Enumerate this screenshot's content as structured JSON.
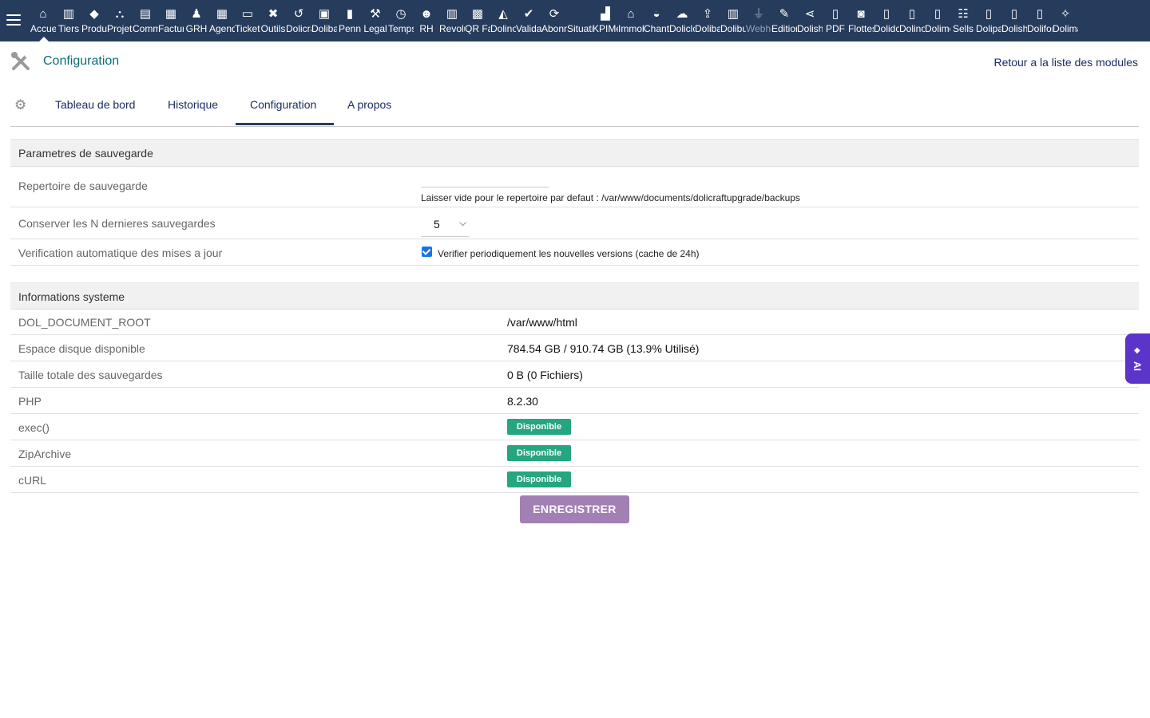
{
  "topbar": {
    "menu_items": [
      {
        "label": "Accueil",
        "icon": "home-icon",
        "glyph": "⌂"
      },
      {
        "label": "Tiers",
        "icon": "building-icon",
        "glyph": "▥"
      },
      {
        "label": "Produits",
        "icon": "cube-icon",
        "glyph": "◆"
      },
      {
        "label": "Projets",
        "icon": "project-icon",
        "glyph": "⛬"
      },
      {
        "label": "Commercial",
        "icon": "briefcase-icon",
        "glyph": "▤"
      },
      {
        "label": "Facturation",
        "icon": "invoice-icon",
        "glyph": "▦"
      },
      {
        "label": "GRH",
        "icon": "user-tie-icon",
        "glyph": "♟"
      },
      {
        "label": "Agenda",
        "icon": "calendar-icon",
        "glyph": "▦"
      },
      {
        "label": "Tickets",
        "icon": "ticket-icon",
        "glyph": "▭"
      },
      {
        "label": "Outils",
        "icon": "tools-icon",
        "glyph": "✖"
      },
      {
        "label": "Dolicraft",
        "icon": "undo-icon",
        "glyph": "↺"
      },
      {
        "label": "Dolibarr",
        "icon": "toolbox-icon",
        "glyph": "▣"
      },
      {
        "label": "Penn",
        "icon": "file-icon",
        "glyph": "▮"
      },
      {
        "label": "Legal",
        "icon": "gavel-icon",
        "glyph": "⚒"
      },
      {
        "label": "Temps",
        "icon": "clock-icon",
        "glyph": "◷"
      },
      {
        "label": "RH",
        "icon": "users-icon",
        "glyph": "☻"
      },
      {
        "label": "Revolut",
        "icon": "bank-icon",
        "glyph": "▥"
      },
      {
        "label": "QR Facture",
        "icon": "qrcode-icon",
        "glyph": "▩"
      },
      {
        "label": "Dolinotif",
        "icon": "bell-icon",
        "glyph": "◭"
      },
      {
        "label": "Validation",
        "icon": "check-double-icon",
        "glyph": "✔"
      },
      {
        "label": "Abonnements",
        "icon": "refresh-icon",
        "glyph": "⟳"
      },
      {
        "label": "Situation",
        "icon": "blank-icon",
        "glyph": ""
      },
      {
        "label": "KPIMetrics",
        "icon": "chart-icon",
        "glyph": "▟"
      },
      {
        "label": "Immobilier",
        "icon": "house-icon",
        "glyph": "⌂"
      },
      {
        "label": "Chantier",
        "icon": "helmet-icon",
        "glyph": "◒"
      },
      {
        "label": "Dolicloud",
        "icon": "cloud-icon",
        "glyph": "☁"
      },
      {
        "label": "Dolibackup",
        "icon": "upload-icon",
        "glyph": "⇪"
      },
      {
        "label": "Dolibuild",
        "icon": "tower-icon",
        "glyph": "▥"
      },
      {
        "label": "Webhooks",
        "icon": "plug-icon",
        "glyph": "⏚",
        "dim": true
      },
      {
        "label": "Editions",
        "icon": "edit-icon",
        "glyph": "✎"
      },
      {
        "label": "Dolishare",
        "icon": "share-icon",
        "glyph": "⋖"
      },
      {
        "label": "PDF",
        "icon": "pdf-icon",
        "glyph": "▯"
      },
      {
        "label": "Flottes",
        "icon": "car-icon",
        "glyph": "◙"
      },
      {
        "label": "Dolidoc",
        "icon": "doc-icon",
        "glyph": "▯"
      },
      {
        "label": "Dolinote",
        "icon": "note-icon",
        "glyph": "▯"
      },
      {
        "label": "Dolimemo",
        "icon": "memo-icon",
        "glyph": "▯"
      },
      {
        "label": "Sells",
        "icon": "handshake-icon",
        "glyph": "☷"
      },
      {
        "label": "Dolipage",
        "icon": "page-icon",
        "glyph": "▯"
      },
      {
        "label": "Dolisheet",
        "icon": "sheet-icon",
        "glyph": "▯"
      },
      {
        "label": "Doliform",
        "icon": "form-icon",
        "glyph": "▯"
      },
      {
        "label": "Dolimagic",
        "icon": "magic-icon",
        "glyph": "✧"
      }
    ]
  },
  "header": {
    "title": "Configuration",
    "back_link": "Retour a la liste des modules"
  },
  "tabs": [
    {
      "label": "Tableau de bord"
    },
    {
      "label": "Historique"
    },
    {
      "label": "Configuration",
      "active": true
    },
    {
      "label": "A propos"
    }
  ],
  "backup_section": {
    "title": "Parametres de sauvegarde",
    "directory_label": "Repertoire de sauvegarde",
    "directory_value": "",
    "directory_hint": "Laisser vide pour le repertoire par defaut : /var/www/documents/dolicraftupgrade/backups",
    "keep_label": "Conserver les N dernieres sauvegardes",
    "keep_value": "5",
    "autocheck_label": "Verification automatique des mises a jour",
    "autocheck_checkbox_label": "Verifier periodiquement les nouvelles versions (cache de 24h)",
    "autocheck_checked": true
  },
  "system_section": {
    "title": "Informations systeme",
    "rows": [
      {
        "key": "DOL_DOCUMENT_ROOT",
        "value": "/var/www/html"
      },
      {
        "key": "Espace disque disponible",
        "value": "784.54 GB / 910.74 GB (13.9% Utilisé)"
      },
      {
        "key": "Taille totale des sauvegardes",
        "value": "0 B (0 Fichiers)"
      },
      {
        "key": "PHP",
        "value": "8.2.30"
      },
      {
        "key": "exec()",
        "badge": "Disponible"
      },
      {
        "key": "ZipArchive",
        "badge": "Disponible"
      },
      {
        "key": "cURL",
        "badge": "Disponible"
      }
    ],
    "badge_color": "#25a580"
  },
  "save_button": "ENREGISTRER",
  "ai_tab": "AI",
  "colors": {
    "topbar": "#263c5c",
    "title_teal": "#0a6f76",
    "link_navy": "#1a2c60",
    "save_purple": "#a27fb4",
    "ai_purple": "#5b35c9"
  }
}
